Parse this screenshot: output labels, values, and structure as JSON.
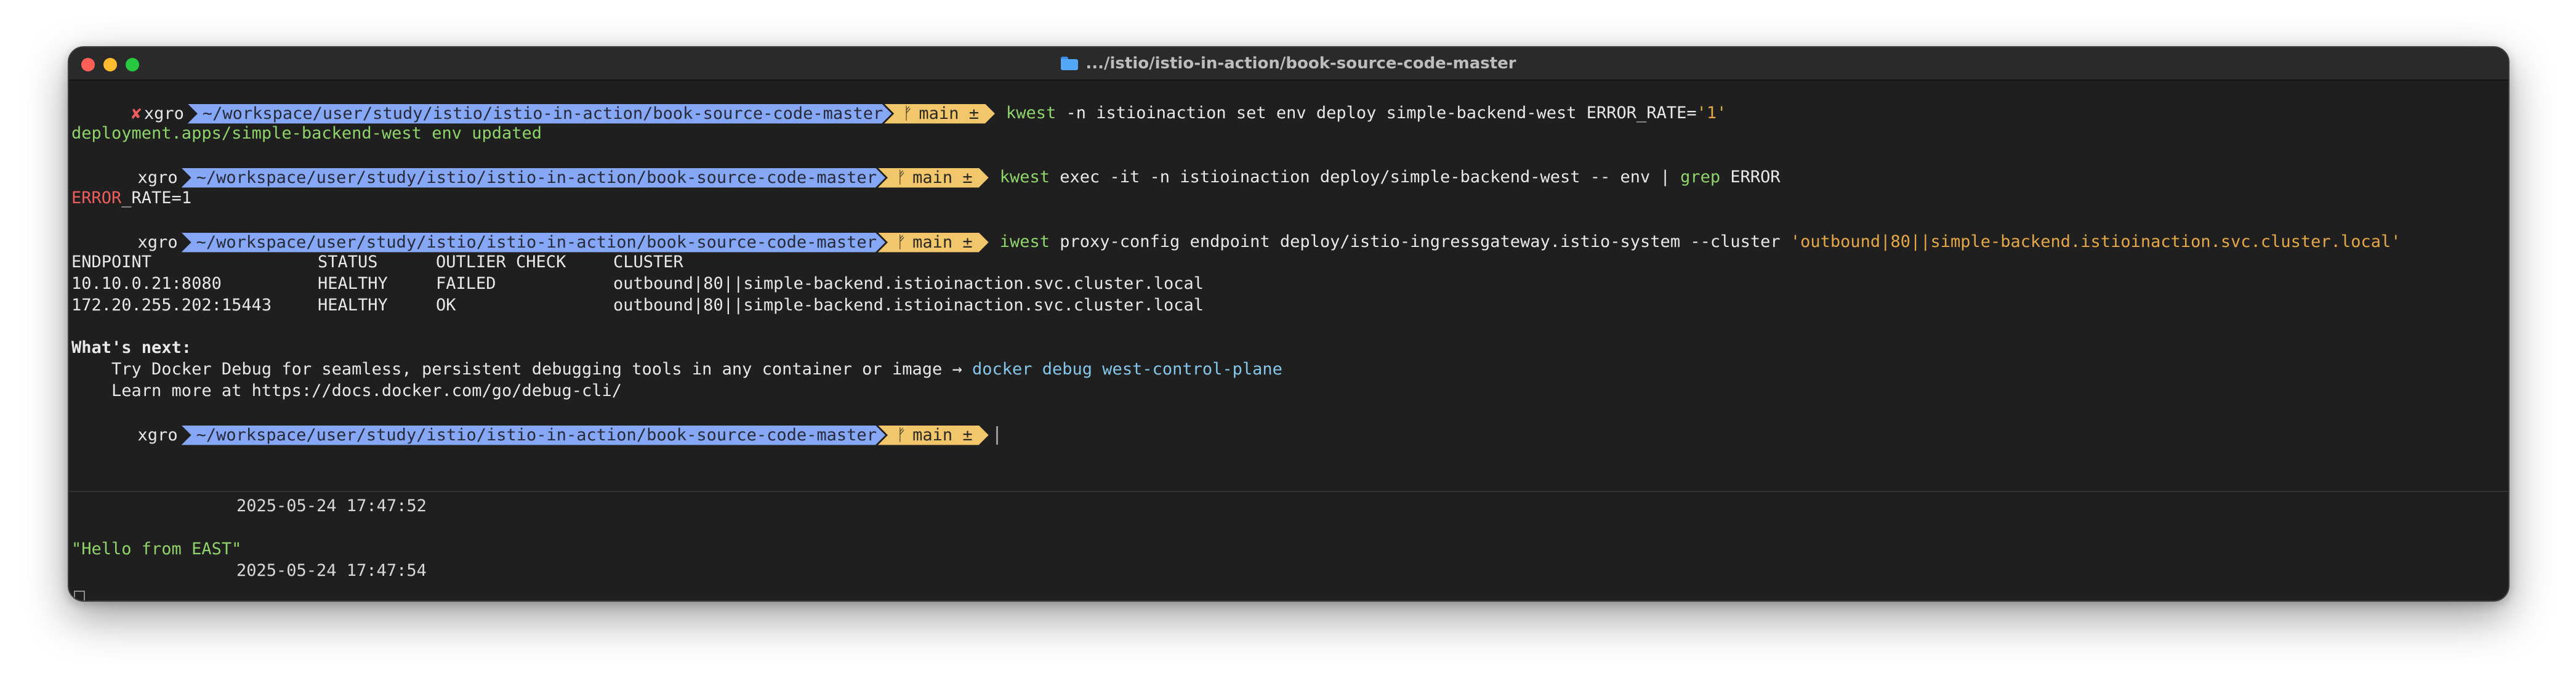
{
  "window": {
    "title": ".../istio/istio-in-action/book-source-code-master"
  },
  "prompt": {
    "user": "xgro",
    "error_mark": "✘",
    "path": "~/workspace/user/study/istio/istio-in-action/book-source-code-master",
    "git_icon": "ᚠ",
    "branch": "main ±"
  },
  "commands": {
    "cmd1": {
      "bin": "kwest",
      "args": " -n istioinaction set env deploy simple-backend-west ERROR_RATE=",
      "value": "'1'"
    },
    "cmd2": {
      "bin": "kwest",
      "args_before": " exec -it -n istioinaction deploy/simple-backend-west -- env | ",
      "grep": "grep",
      "args_after": " ERROR"
    },
    "cmd3": {
      "bin": "iwest",
      "args": " proxy-config endpoint deploy/istio-ingressgateway.istio-system --cluster ",
      "value": "'outbound|80||simple-backend.istioinaction.svc.cluster.local'"
    }
  },
  "output": {
    "deploy_updated": "deployment.apps/simple-backend-west env updated",
    "env_key": "ERROR",
    "env_rest": "_RATE=1",
    "table": {
      "headers": [
        "ENDPOINT",
        "STATUS",
        "OUTLIER CHECK",
        "CLUSTER"
      ],
      "rows": [
        [
          "10.10.0.21:8080",
          "HEALTHY",
          "FAILED",
          "outbound|80||simple-backend.istioinaction.svc.cluster.local"
        ],
        [
          "172.20.255.202:15443",
          "HEALTHY",
          "OK",
          "outbound|80||simple-backend.istioinaction.svc.cluster.local"
        ]
      ]
    },
    "whats_next": "What's next:",
    "tip1_text": "    Try Docker Debug for seamless, persistent debugging tools in any container or image → ",
    "tip1_cmd": "docker debug west-control-plane",
    "tip2_text": "    Learn more at https://docs.docker.com/go/debug-cli/"
  },
  "lower_pane": {
    "time1": "2025-05-24 17:47:52",
    "hello": "\"Hello from EAST\"",
    "time2": "2025-05-24 17:47:54"
  },
  "colors": {
    "path_segment": "#86a7f5",
    "git_segment": "#f2c66a",
    "command": "#8fd46a",
    "string": "#e6a847",
    "error": "#ee5d5d",
    "link": "#85c7ea"
  }
}
